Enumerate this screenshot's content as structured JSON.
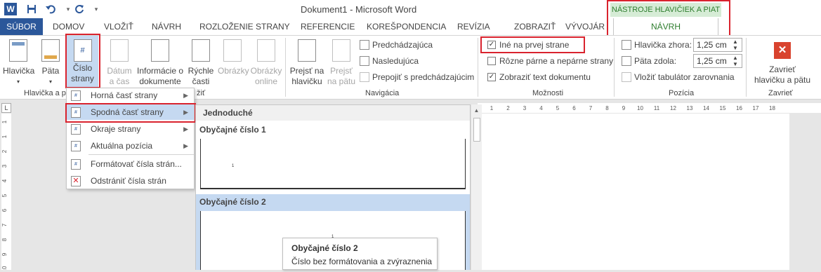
{
  "app": {
    "logo": "W",
    "title": "Dokument1 - Microsoft Word"
  },
  "qat": {
    "icons": [
      "save-icon",
      "undo-icon",
      "redo-icon",
      "customize-qat-icon"
    ]
  },
  "tabs": {
    "file": "SÚBOR",
    "items": [
      "DOMOV",
      "VLOŽIŤ",
      "NÁVRH",
      "ROZLOŽENIE STRANY",
      "REFERENCIE",
      "KOREŠPONDENCIA",
      "REVÍZIA",
      "ZOBRAZIŤ",
      "VÝVOJÁR"
    ],
    "contextual_header": "NÁSTROJE HLAVIČIEK A PIAT",
    "contextual_tab": "NÁVRH"
  },
  "ribbon": {
    "hf_group": {
      "header": "Hlavička",
      "footer": "Päta",
      "page_number": [
        "Číslo",
        "strany"
      ],
      "label": "Hlavička a pä"
    },
    "insert_group": {
      "date_time": [
        "Dátum",
        "a čas"
      ],
      "doc_info": [
        "Informácie o",
        "dokumente"
      ],
      "quick_parts": [
        "Rýchle",
        "časti"
      ],
      "pictures": "Obrázky",
      "online_pictures": [
        "Obrázky",
        "online"
      ],
      "label_fragment": "žiť"
    },
    "nav_group": {
      "goto_header": [
        "Prejsť na",
        "hlavičku"
      ],
      "goto_footer": [
        "Prejsť",
        "na pätu"
      ],
      "previous": "Predchádzajúca",
      "next": "Nasledujúca",
      "link_previous": "Prepojiť s predchádzajúcim",
      "label": "Navigácia"
    },
    "options_group": {
      "different_first": "Iné na prvej strane",
      "different_odd_even": "Rôzne párne a nepárne strany",
      "show_document_text": "Zobraziť text dokumentu",
      "check_mark": "✓",
      "label": "Možnosti"
    },
    "position_group": {
      "header_top_label": "Hlavička zhora:",
      "header_top_value": "1,25 cm",
      "footer_bottom_label": "Päta zdola:",
      "footer_bottom_value": "1,25 cm",
      "insert_tab": "Vložiť tabulátor zarovnania",
      "label": "Pozícia"
    },
    "close_group": {
      "close": [
        "Zavrieť",
        "hlavičku a pätu"
      ],
      "label": "Zavrieť",
      "close_glyph": "✕"
    }
  },
  "page_number_menu": {
    "items": [
      {
        "label": "Horná časť strany",
        "submenu": true
      },
      {
        "label": "Spodná časť strany",
        "submenu": true
      },
      {
        "label": "Okraje strany",
        "submenu": true
      },
      {
        "label": "Aktuálna pozícia",
        "submenu": true
      },
      {
        "label": "Formátovať čísla strán...",
        "submenu": false
      },
      {
        "label": "Odstrániť čísla strán",
        "submenu": false
      }
    ],
    "submenu_arrow": "▶"
  },
  "gallery": {
    "section": "Jednoduché",
    "items": [
      {
        "title": "Obyčajné číslo 1",
        "sample": "1"
      },
      {
        "title": "Obyčajné číslo 2",
        "sample": "1"
      }
    ]
  },
  "tooltip": {
    "title": "Obyčajné číslo 2",
    "text": "Číslo bez formátovania a zvýraznenia"
  },
  "ruler": {
    "h_ticks": [
      "1",
      "2",
      "3",
      "4",
      "5",
      "6",
      "7",
      "8",
      "9",
      "10",
      "11",
      "12",
      "13",
      "14",
      "15",
      "16",
      "17",
      "18"
    ],
    "v_ticks": [
      "1",
      "1",
      "2",
      "3",
      "4",
      "5",
      "6",
      "7",
      "8",
      "9",
      "10"
    ]
  },
  "colors": {
    "accent": "#2b579a",
    "contextual": "#2d7d2d",
    "highlight_box": "#d9232e",
    "selected": "#c5d9f1"
  }
}
